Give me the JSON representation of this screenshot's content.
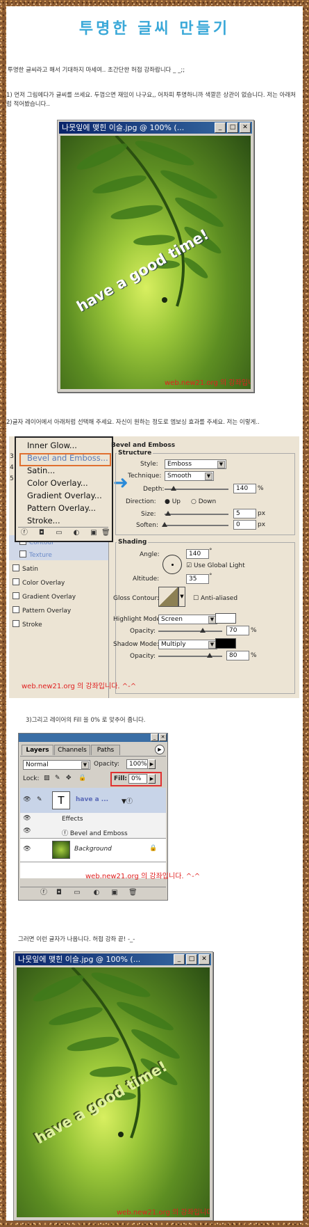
{
  "title": "투명한 글씨 만들기",
  "intro": "투명한 글씨라고 해서 기대하지 마세여.. 초간단한 허접 강좌랍니다 _ _;;",
  "step1": "1) 먼저 그림에다가 글씨를 쓰세요. 두껍으면 재밌이 나구요,, 어차피 투명하니까 색깔은 상관이 없습니다. 저는 아래처럼 적어봤습니다..",
  "window1": {
    "title": "나뭇잎에 맺힌 이슬.jpg @ 100% (...",
    "photo_text": "have a good time!",
    "watermark": "web.new21.org 의 강좌입니다. ^-^"
  },
  "step2": "2)글자 레이어에서 아래처럼 선택해 주세요. 자신이 원하는 정도로 엠보싱 효과를 주세요. 저는 이렇게..",
  "style_menu": {
    "items": [
      "Inner Glow...",
      "Bevel and Emboss...",
      "Satin...",
      "Color Overlay...",
      "Gradient Overlay...",
      "Pattern Overlay...",
      "Stroke..."
    ],
    "selected": "Bevel and Emboss..."
  },
  "style_list": {
    "sub_items": [
      "Contour",
      "Texture"
    ],
    "items": [
      "Satin",
      "Color Overlay",
      "Gradient Overlay",
      "Pattern Overlay",
      "Stroke"
    ],
    "side_marks": [
      "3",
      "4",
      "5"
    ]
  },
  "bevel": {
    "heading": "Bevel and Emboss",
    "structure": "Structure",
    "style_label": "Style:",
    "style_value": "Emboss",
    "technique_label": "Technique:",
    "technique_value": "Smooth",
    "depth_label": "Depth:",
    "depth_value": "140",
    "depth_unit": "%",
    "depth_fraction": 0.14,
    "direction_label": "Direction:",
    "direction_up": "Up",
    "direction_down": "Down",
    "size_label": "Size:",
    "size_value": "5",
    "size_unit": "px",
    "size_fraction": 0.05,
    "soften_label": "Soften:",
    "soften_value": "0",
    "soften_unit": "px",
    "soften_fraction": 0.0,
    "shading": "Shading",
    "angle_label": "Angle:",
    "angle_value": "140",
    "degree": "°",
    "global_light": "Use Global Light",
    "altitude_label": "Altitude:",
    "altitude_value": "35",
    "gloss_label": "Gloss Contour:",
    "anti_aliased": "Anti-aliased",
    "highlight_label": "Highlight Mode:",
    "highlight_value": "Screen",
    "highlight_color": "#ffffff",
    "opacity_label": "Opacity:",
    "hl_opacity": "70",
    "hl_opacity_fraction": 0.7,
    "shadow_label": "Shadow Mode:",
    "shadow_value": "Multiply",
    "shadow_color": "#000000",
    "sh_opacity": "80",
    "sh_opacity_fraction": 0.8,
    "percent": "%"
  },
  "watermark2": "web.new21.org 의 강좌입니다. ^-^",
  "step3": "3)그리고 레이어의 Fill 을 0% 로 맞추어 줍니다.",
  "layers": {
    "tabs": [
      "Layers",
      "Channels",
      "Paths"
    ],
    "blend_mode": "Normal",
    "opacity_label": "Opacity:",
    "opacity_value": "100%",
    "lock_label": "Lock:",
    "fill_label": "Fill:",
    "fill_value": "0%",
    "text_layer": "have a ...",
    "effects": "Effects",
    "effect_item": "Bevel and Emboss",
    "bg_layer": "Background",
    "t_glyph": "T",
    "watermark": "web.new21.org 의 강좌입니다. ^-^"
  },
  "step4": "그러면 이런 글자가 나옵니다. 허접 강좌 끝! -_-",
  "window2": {
    "title": "나뭇잎에 맺힌 이슬.jpg @ 100% (...",
    "photo_text": "have a good time!",
    "watermark": "web.new21.org 의 강좌입니다. ^-^"
  },
  "colors": {
    "title": "#3aa8d8",
    "watermark": "#e02020",
    "menu_highlight": "#e07030",
    "arrow": "#2a8ad8"
  }
}
